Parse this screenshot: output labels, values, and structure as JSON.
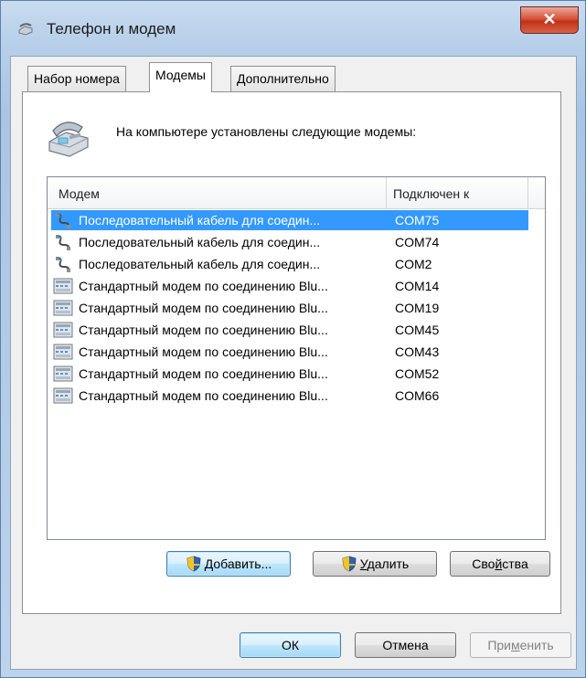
{
  "window": {
    "title": "Телефон и модем",
    "close_glyph": "✕"
  },
  "tabs": [
    {
      "label": "Набор номера",
      "active": false
    },
    {
      "label": "Модемы",
      "active": true
    },
    {
      "label": "Дополнительно",
      "active": false
    }
  ],
  "intro_text": "На компьютере установлены следующие модемы:",
  "list": {
    "columns": [
      "Модем",
      "Подключен к"
    ],
    "rows": [
      {
        "icon": "serial-cable-icon",
        "name": "Последовательный кабель для соедин...",
        "port": "COM75",
        "selected": true
      },
      {
        "icon": "serial-cable-icon",
        "name": "Последовательный кабель для соедин...",
        "port": "COM74",
        "selected": false
      },
      {
        "icon": "serial-cable-icon",
        "name": "Последовательный кабель для соедин...",
        "port": "COM2",
        "selected": false
      },
      {
        "icon": "modem-icon",
        "name": "Стандартный модем по соединению Blu...",
        "port": "COM14",
        "selected": false
      },
      {
        "icon": "modem-icon",
        "name": "Стандартный модем по соединению Blu...",
        "port": "COM19",
        "selected": false
      },
      {
        "icon": "modem-icon",
        "name": "Стандартный модем по соединению Blu...",
        "port": "COM45",
        "selected": false
      },
      {
        "icon": "modem-icon",
        "name": "Стандартный модем по соединению Blu...",
        "port": "COM43",
        "selected": false
      },
      {
        "icon": "modem-icon",
        "name": "Стандартный модем по соединению Blu...",
        "port": "COM52",
        "selected": false
      },
      {
        "icon": "modem-icon",
        "name": "Стандартный модем по соединению Blu...",
        "port": "COM66",
        "selected": false
      }
    ]
  },
  "buttons": {
    "add": {
      "pre": "",
      "ul": "Д",
      "post": "обавить..."
    },
    "remove": {
      "pre": "",
      "ul": "У",
      "post": "далить"
    },
    "properties": {
      "pre": "Сво",
      "ul": "й",
      "post": "ства"
    },
    "ok": "ОК",
    "cancel": "Отмена",
    "apply": {
      "pre": "При",
      "ul": "м",
      "post": "енить"
    }
  },
  "colors": {
    "selection": "#3399ff",
    "close_button": "#c8391e",
    "focus_border": "#3c7fb1"
  }
}
